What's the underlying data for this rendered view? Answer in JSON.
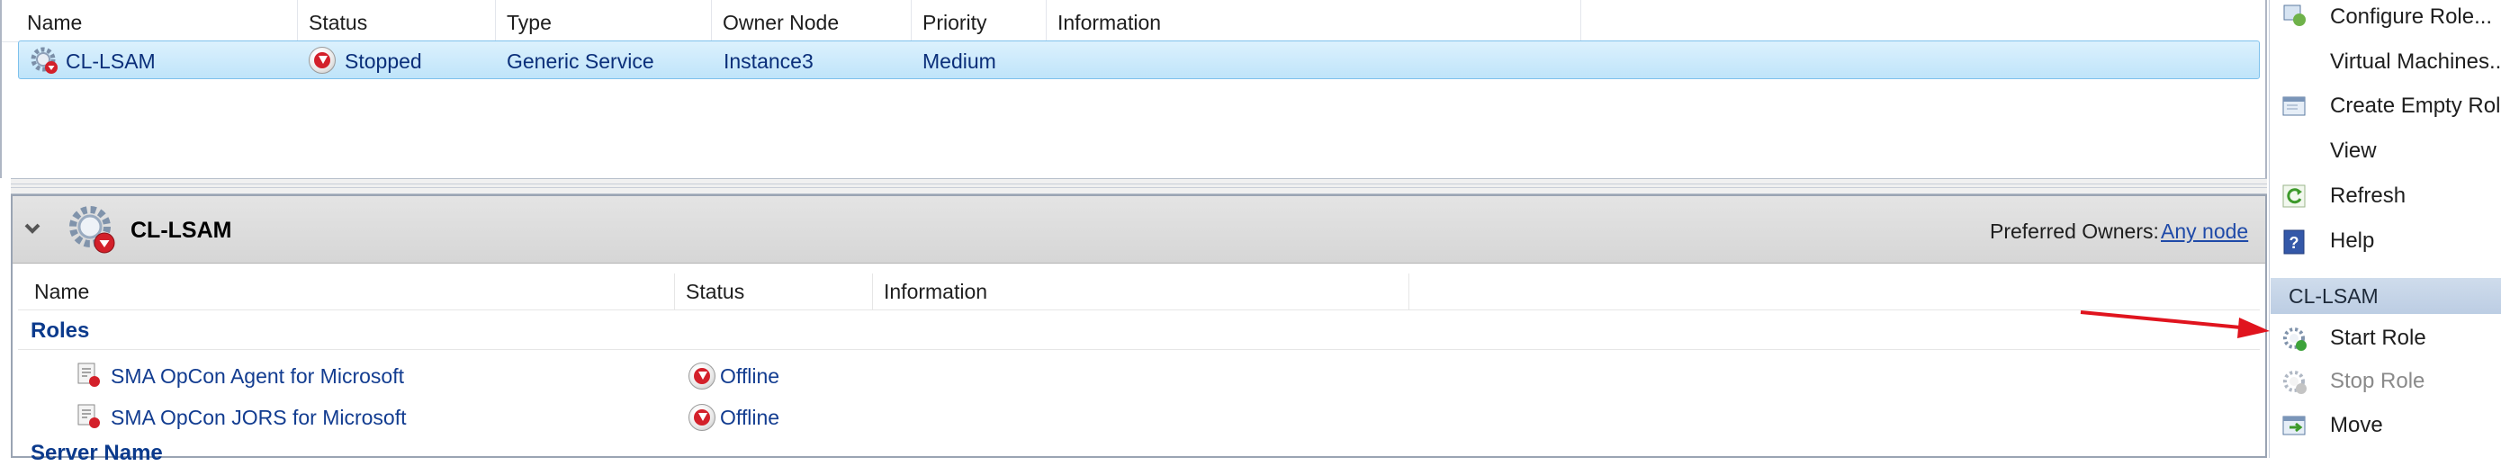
{
  "roles_list": {
    "columns": [
      "Name",
      "Status",
      "Type",
      "Owner Node",
      "Priority",
      "Information"
    ],
    "row": {
      "name": "CL-LSAM",
      "status": "Stopped",
      "type": "Generic Service",
      "owner_node": "Instance3",
      "priority": "Medium",
      "information": ""
    }
  },
  "details": {
    "title": "CL-LSAM",
    "preferred_owners_label": "Preferred Owners:",
    "preferred_owners_value": "Any node",
    "columns": [
      "Name",
      "Status",
      "Information"
    ],
    "group_label": "Roles",
    "resources": [
      {
        "name": "SMA OpCon Agent for Microsoft",
        "status": "Offline"
      },
      {
        "name": "SMA OpCon JORS for Microsoft",
        "status": "Offline"
      }
    ],
    "next_group_label": "Server Name"
  },
  "actions": {
    "items": [
      {
        "label": "Configure Role...",
        "icon": "configure-role-icon"
      },
      {
        "label": "Virtual Machines...",
        "icon": ""
      },
      {
        "label": "Create Empty Role",
        "icon": "create-empty-role-icon"
      },
      {
        "label": "View",
        "icon": ""
      },
      {
        "label": "Refresh",
        "icon": "refresh-icon"
      },
      {
        "label": "Help",
        "icon": "help-icon"
      }
    ],
    "section_title": "CL-LSAM",
    "section_items": [
      {
        "label": "Start Role",
        "icon": "start-role-icon",
        "enabled": true
      },
      {
        "label": "Stop Role",
        "icon": "stop-role-icon",
        "enabled": false
      },
      {
        "label": "Move",
        "icon": "move-icon",
        "enabled": true
      }
    ]
  },
  "colors": {
    "selection": "#bfe4fa",
    "link": "#1f4aa8",
    "status_stopped": "#d3202a",
    "annotation_arrow": "#e0141e"
  }
}
